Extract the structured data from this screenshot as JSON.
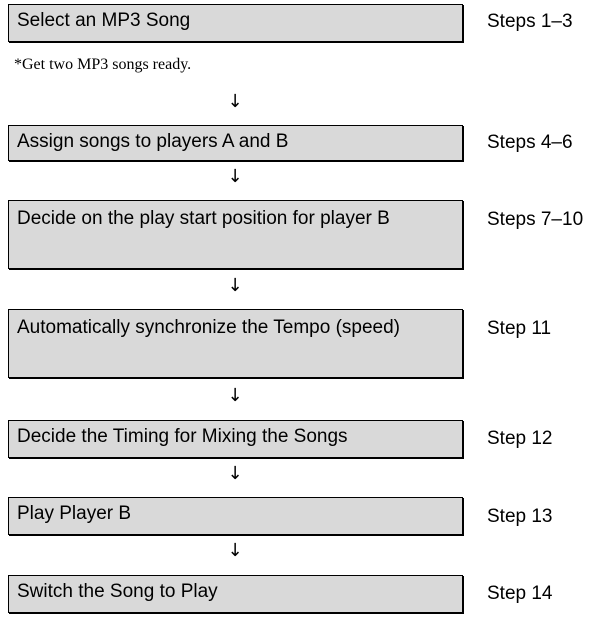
{
  "flow": {
    "note": "*Get two MP3 songs ready.",
    "arrow_glyph": "↓",
    "steps": [
      {
        "label": "Select an MP3 Song",
        "ref": "Steps 1–3"
      },
      {
        "label": "Assign songs to players A and B",
        "ref": "Steps 4–6"
      },
      {
        "label": "Decide on the play start position for player B",
        "ref": "Steps 7–10"
      },
      {
        "label": "Automatically synchronize the Tempo (speed)",
        "ref": "Step 11"
      },
      {
        "label": "Decide the Timing for Mixing the Songs",
        "ref": "Step 12"
      },
      {
        "label": "Play Player B",
        "ref": "Step 13"
      },
      {
        "label": "Switch the Song to Play",
        "ref": "Step 14"
      }
    ]
  }
}
